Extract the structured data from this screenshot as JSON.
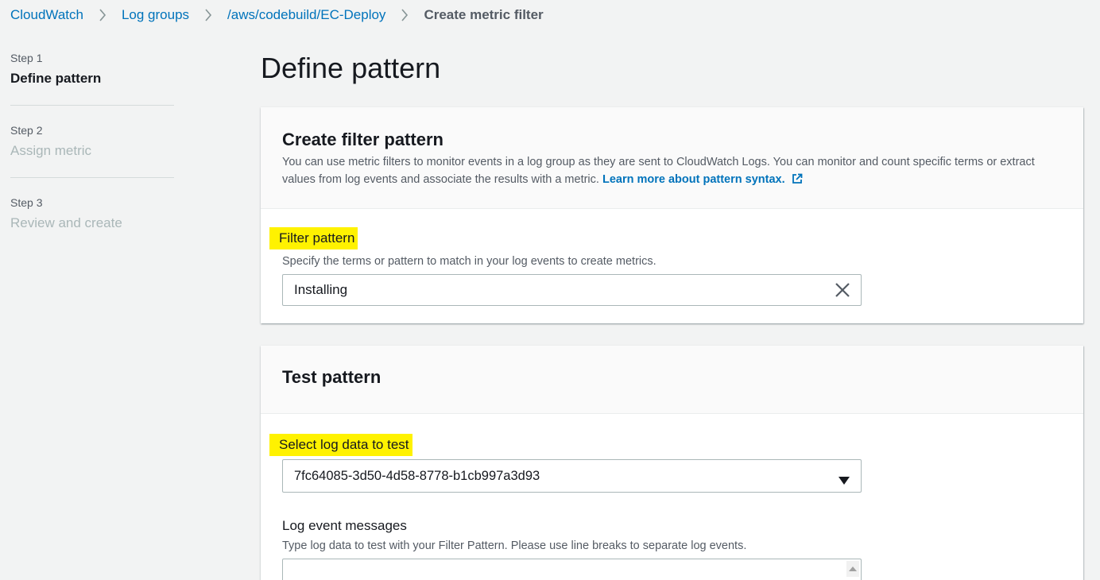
{
  "breadcrumb": {
    "items": [
      "CloudWatch",
      "Log groups",
      "/aws/codebuild/EC-Deploy"
    ],
    "current": "Create metric filter"
  },
  "steps": [
    {
      "number": "Step 1",
      "title": "Define pattern",
      "state": "active"
    },
    {
      "number": "Step 2",
      "title": "Assign metric",
      "state": "inactive"
    },
    {
      "number": "Step 3",
      "title": "Review and create",
      "state": "inactive"
    }
  ],
  "page": {
    "title": "Define pattern"
  },
  "filter_section": {
    "title": "Create filter pattern",
    "description": "You can use metric filters to monitor events in a log group as they are sent to CloudWatch Logs. You can monitor and count specific terms or extract values from log events and associate the results with a metric.",
    "learn_more": "Learn more about pattern syntax.",
    "field_label": "Filter pattern",
    "field_description": "Specify the terms or pattern to match in your log events to create metrics.",
    "value": "Installing"
  },
  "test_section": {
    "title": "Test pattern",
    "select_label": "Select log data to test",
    "select_value": "7fc64085-3d50-4d58-8778-b1cb997a3d93",
    "messages_label": "Log event messages",
    "messages_description": "Type log data to test with your Filter Pattern. Please use line breaks to separate log events."
  },
  "colors": {
    "link": "#0073bb",
    "highlight": "#fff200",
    "background": "#f2f3f3",
    "inactive_text": "#aab7b8"
  },
  "icons": {
    "breadcrumb_separator": "chevron-right-icon",
    "clear": "close-icon",
    "select": "caret-down-icon",
    "external_link": "external-link-icon"
  }
}
